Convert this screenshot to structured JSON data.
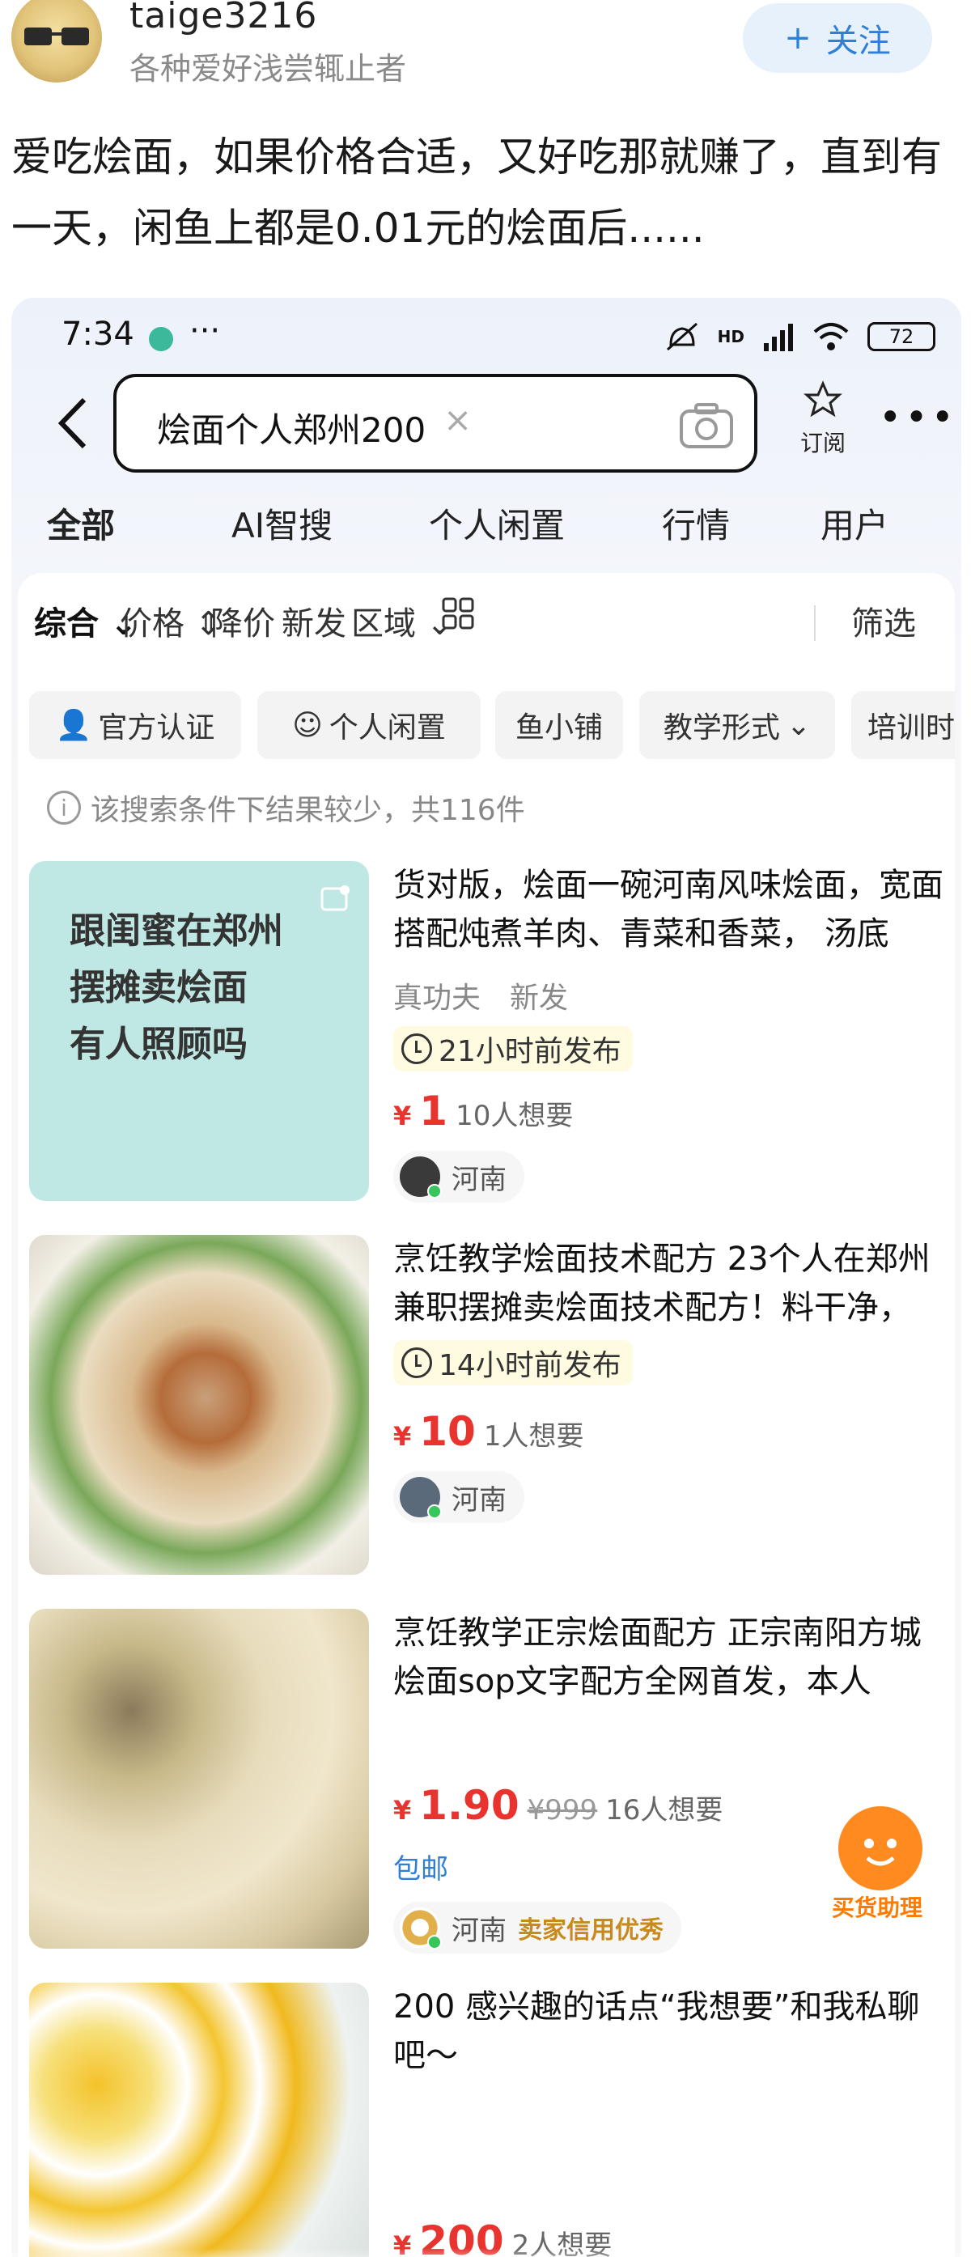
{
  "post": {
    "username": "taige3216",
    "signature": "各种爱好浅尝辄止者",
    "follow_label": "关注",
    "follow_plus": "+",
    "text": "爱吃烩面，如果价格合适，又好吃那就赚了，直到有一天，闲鱼上都是0.01元的烩面后......"
  },
  "phone": {
    "status": {
      "time": "7:34",
      "more": "···",
      "network": "HD",
      "battery": "72"
    },
    "search": {
      "query": "烩面个人郑州200",
      "clear": "×"
    },
    "subscribe_label": "订阅",
    "more": "•••",
    "tabs": [
      "全部",
      "AI智搜",
      "个人闲置",
      "行情",
      "用户"
    ],
    "sort": {
      "comprehensive": "综合",
      "price": "价格",
      "price_drop": "降价",
      "new": "新发",
      "region": "区域",
      "filter": "筛选"
    },
    "chips": [
      "官方认证",
      "个人闲置",
      "鱼小铺",
      "教学形式",
      "培训时"
    ],
    "notice": "该搜索条件下结果较少，共116件",
    "items": [
      {
        "thumb_text": [
          "跟闺蜜在郑州",
          "摆摊卖烩面",
          "有人照顾吗"
        ],
        "title": "货对版，烩面一碗河南风味烩面，宽面搭配炖煮羊肉、青菜和香菜， 汤底",
        "tags": [
          "真功夫",
          "新发"
        ],
        "time": "21小时前发布",
        "yen": "¥",
        "price": "1",
        "want": "10人想要",
        "region": "河南"
      },
      {
        "title": "烹饪教学烩面技术配方 23个人在郑州兼职摆摊卖烩面技术配方！料干净，",
        "time": "14小时前发布",
        "yen": "¥",
        "price": "10",
        "want": "1人想要",
        "region": "河南"
      },
      {
        "title": "烹饪教学正宗烩面配方 正宗南阳方城烩面sop文字配方全网首发，本人",
        "yen": "¥",
        "price": "1.90",
        "orig": "¥999",
        "want": "16人想要",
        "baoyou": "包邮",
        "region": "河南",
        "credit": "卖家信用优秀"
      },
      {
        "title": "200 感兴趣的话点“我想要”和我私聊吧～",
        "yen": "¥",
        "price": "200",
        "want": "2人想要"
      }
    ],
    "assistant_label": "买货助理"
  },
  "colors": {
    "accent_price": "#e8332f",
    "tab_highlight": "#ffe433",
    "follow_blue": "#2f7fd8"
  }
}
